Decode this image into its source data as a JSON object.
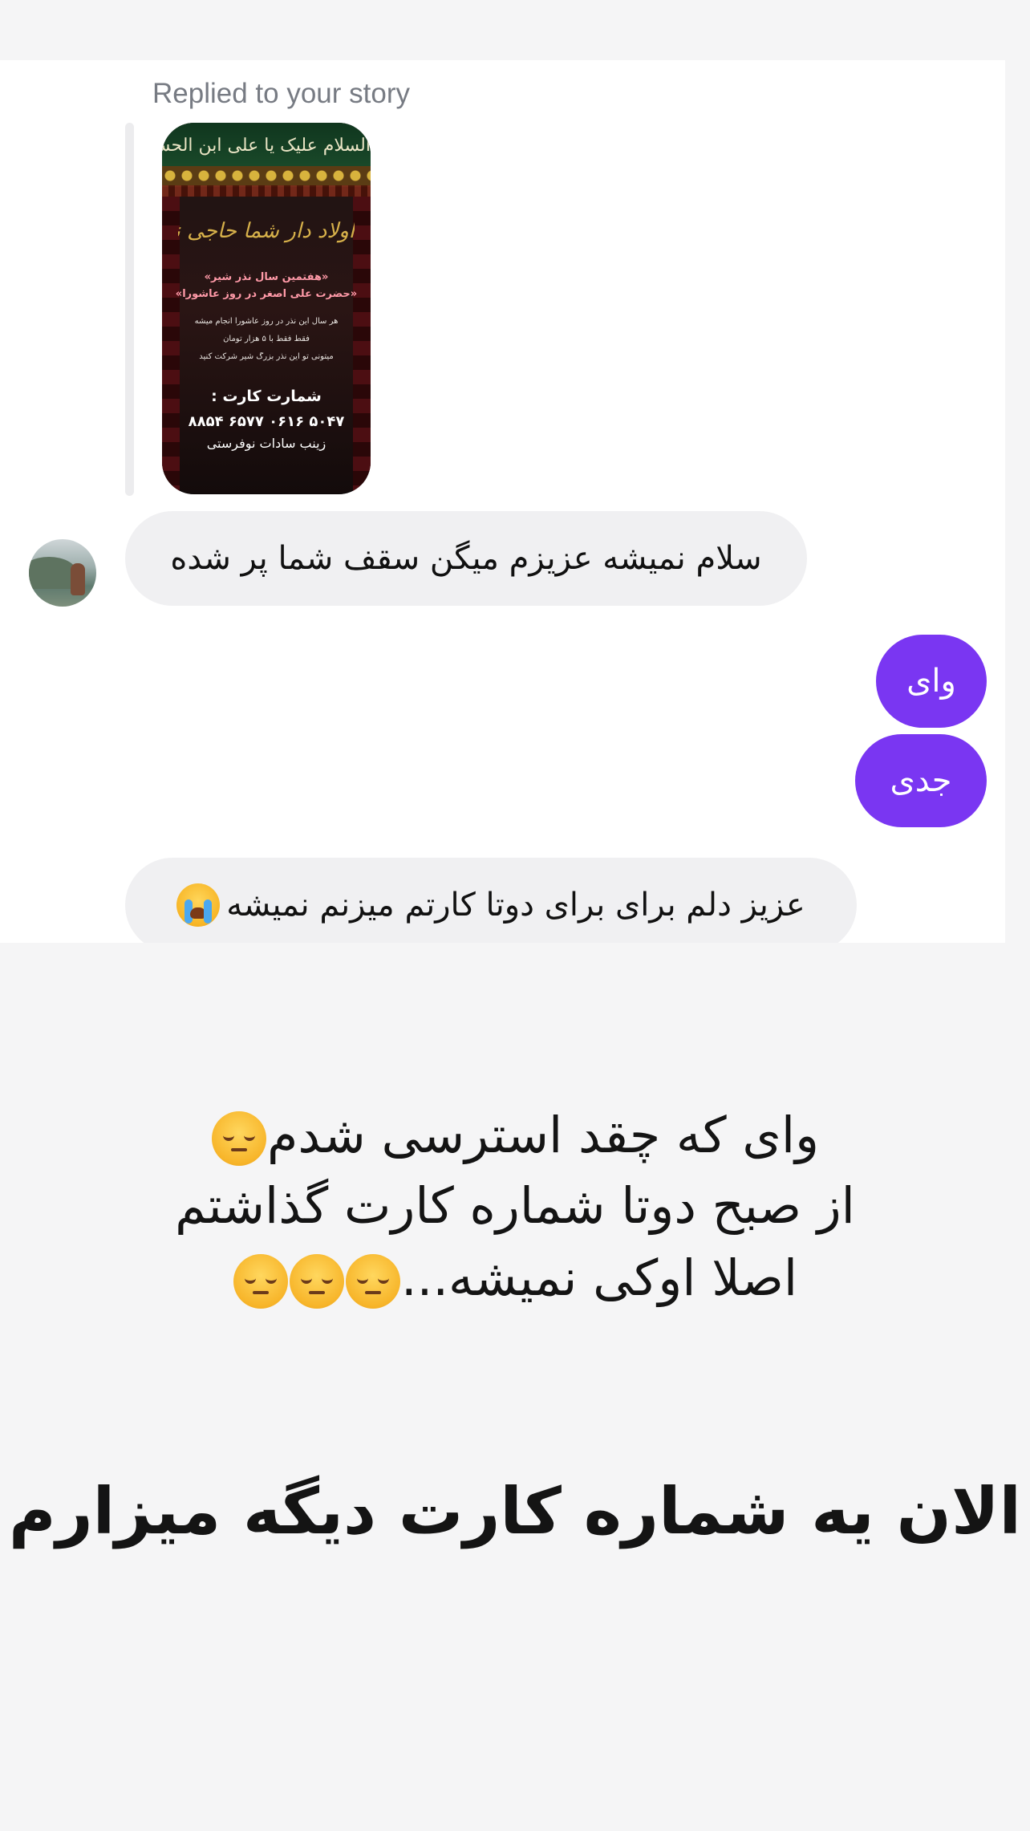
{
  "thread": {
    "reply_context": "Replied to your story",
    "story": {
      "banner_text": "السلام علیک یا علی ابن الحسین الاصغر",
      "calligraphy": "اولاد دار شما حاجی نمی شود",
      "line1": "«هفتمین سال نذر شیر»",
      "line2": "«حضرت علی اصغر در روز عاشورا»",
      "small1": "هر سال این نذر در روز عاشورا انجام میشه",
      "small2": "فقط فقط با ۵ هزار تومان",
      "small3": "میتونی تو این نذر بزرگ شیر شرکت کنید",
      "card_title": "شمارت کارت :",
      "card_number": "۵۰۴۷ ۰۶۱۶ ۶۵۷۷ ۸۸۵۴",
      "card_owner": "زینب سادات نوفرستی"
    },
    "messages": [
      {
        "from": "them",
        "text": "سلام نمیشه عزیزم میگن سقف شما پر شده"
      },
      {
        "from": "me",
        "text": "وای"
      },
      {
        "from": "me",
        "text": "جدی"
      },
      {
        "from": "them",
        "text": "عزیز دلم برای برای دوتا کارتم میزنم نمیشه",
        "emoji": "loudly-crying-face"
      }
    ]
  },
  "overlay_caption": {
    "line1": "وای که چقد استرسی شدم",
    "line2": "از صبح دوتا شماره کارت گذاشتم",
    "line3": "اصلا اوکی نمیشه...",
    "line4": "الان یه شماره کارت دیگه میزارم",
    "emoji": "pensive-face"
  },
  "colors": {
    "outgoing_bubble": "#7a36f2",
    "incoming_bubble": "#f0f0f2",
    "background": "#f5f5f6"
  }
}
